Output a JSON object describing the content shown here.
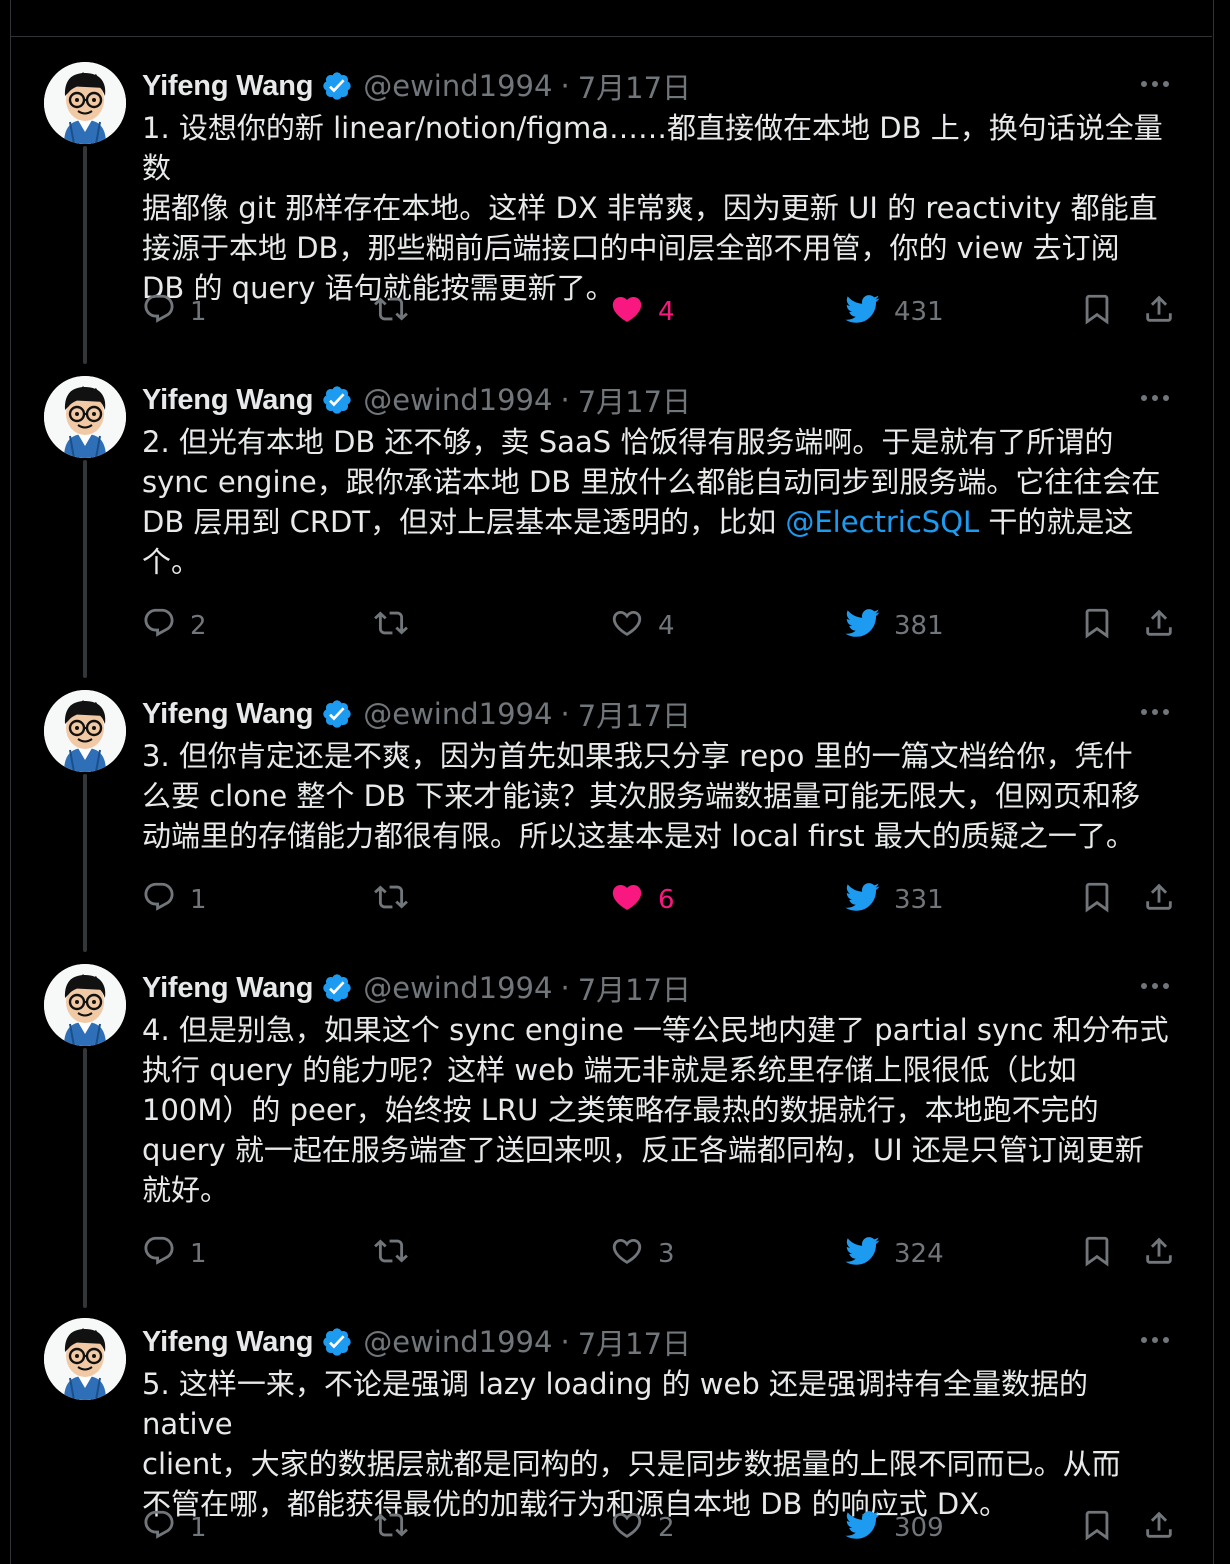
{
  "author": {
    "name": "Yifeng Wang",
    "handle": "@ewind1994",
    "separator": "·"
  },
  "icons": {
    "verified": "verified-badge-icon",
    "more": "more-dots-icon",
    "reply": "reply-icon",
    "retweet": "retweet-icon",
    "like": "heart-icon",
    "views": "twitter-bird-icon",
    "bookmark": "bookmark-icon",
    "share": "share-icon"
  },
  "colors": {
    "background": "#000000",
    "text": "#e7e9ea",
    "muted": "#71767b",
    "accent": "#1d9bf0",
    "like": "#f91880"
  },
  "tweets": [
    {
      "date": "7月17日",
      "text": "1. 设想你的新 linear/notion/figma……都直接做在本地 DB 上，换句话说全量数\n据都像 git 那样存在本地。这样 DX 非常爽，因为更新 UI 的 reactivity 都能直\n接源于本地 DB，那些糊前后端接口的中间层全部不用管，你的 view 去订阅\nDB 的 query 语句就能按需更新了。",
      "replies": "1",
      "retweets": "",
      "likes": "4",
      "liked": true,
      "views": "431"
    },
    {
      "date": "7月17日",
      "text_before": "2. 但光有本地 DB 还不够，卖 SaaS 恰饭得有服务端啊。于是就有了所谓的\nsync engine，跟你承诺本地 DB 里放什么都能自动同步到服务端。它往往会在\nDB 层用到 CRDT，但对上层基本是透明的，比如 ",
      "mention": "@ElectricSQL",
      "text_after": " 干的就是这\n个。",
      "replies": "2",
      "retweets": "",
      "likes": "4",
      "liked": false,
      "views": "381"
    },
    {
      "date": "7月17日",
      "text": "3. 但你肯定还是不爽，因为首先如果我只分享 repo 里的一篇文档给你，凭什\n么要 clone 整个 DB 下来才能读？其次服务端数据量可能无限大，但网页和移\n动端里的存储能力都很有限。所以这基本是对 local first 最大的质疑之一了。",
      "replies": "1",
      "retweets": "",
      "likes": "6",
      "liked": true,
      "views": "331"
    },
    {
      "date": "7月17日",
      "text": "4. 但是别急，如果这个 sync engine 一等公民地内建了 partial sync 和分布式\n执行 query 的能力呢？这样 web 端无非就是系统里存储上限很低（比如\n100M）的 peer，始终按 LRU 之类策略存最热的数据就行，本地跑不完的\nquery 就一起在服务端查了送回来呗，反正各端都同构，UI 还是只管订阅更新\n就好。",
      "replies": "1",
      "retweets": "",
      "likes": "3",
      "liked": false,
      "views": "324"
    },
    {
      "date": "7月17日",
      "text": "5. 这样一来，不论是强调 lazy loading 的 web 还是强调持有全量数据的 native\nclient，大家的数据层就都是同构的，只是同步数据量的上限不同而已。从而\n不管在哪，都能获得最优的加载行为和源自本地 DB 的响应式 DX。",
      "replies": "1",
      "retweets": "",
      "likes": "2",
      "liked": false,
      "views": "309"
    }
  ]
}
